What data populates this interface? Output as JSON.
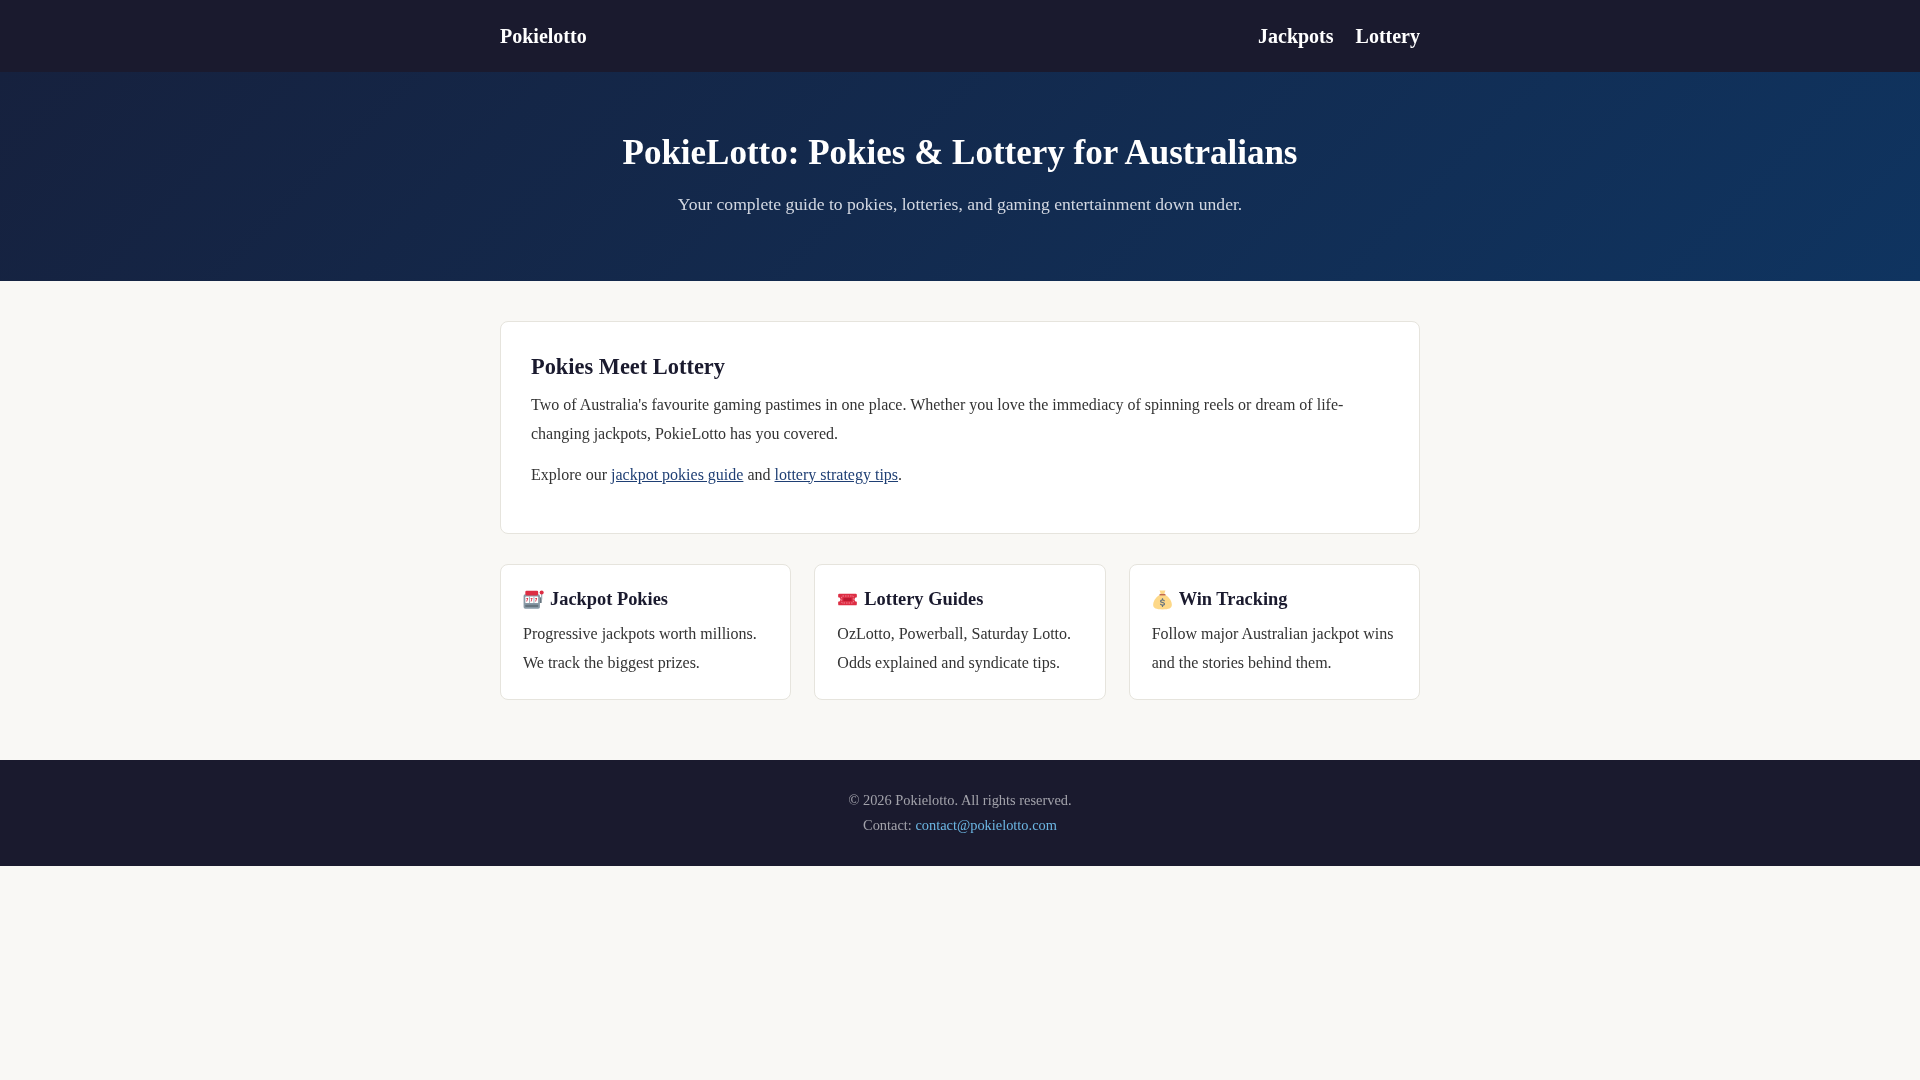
{
  "header": {
    "logo": "Pokielotto",
    "nav": [
      {
        "label": "Jackpots"
      },
      {
        "label": "Lottery"
      }
    ]
  },
  "hero": {
    "title": "PokieLotto: Pokies & Lottery for Australians",
    "subtitle": "Your complete guide to pokies, lotteries, and gaming entertainment down under."
  },
  "intro_card": {
    "heading": "Pokies Meet Lottery",
    "paragraph": "Two of Australia's favourite gaming pastimes in one place. Whether you love the immediacy of spinning reels or dream of life-changing jackpots, PokieLotto has you covered.",
    "explore": [
      {
        "kind": "text",
        "text": "Explore our "
      },
      {
        "kind": "link",
        "text": "jackpot pokies guide"
      },
      {
        "kind": "text",
        "text": " and "
      },
      {
        "kind": "link",
        "text": "lottery strategy tips"
      },
      {
        "kind": "text",
        "text": "."
      }
    ]
  },
  "features": [
    {
      "kind": "slots",
      "title": "Jackpot Pokies",
      "text": "Progressive jackpots worth millions. We track the biggest prizes."
    },
    {
      "kind": "ticket",
      "title": "Lottery Guides",
      "text": "OzLotto, Powerball, Saturday Lotto. Odds explained and syndicate tips."
    },
    {
      "kind": "moneybag",
      "title": "Win Tracking",
      "text": "Follow major Australian jackpot wins and the stories behind them."
    }
  ],
  "footer": {
    "copyright": "© 2026 Pokielotto. All rights reserved.",
    "contact": [
      {
        "kind": "text",
        "text": "Contact: "
      },
      {
        "kind": "link",
        "text": "contact@pokielotto.com"
      }
    ]
  }
}
